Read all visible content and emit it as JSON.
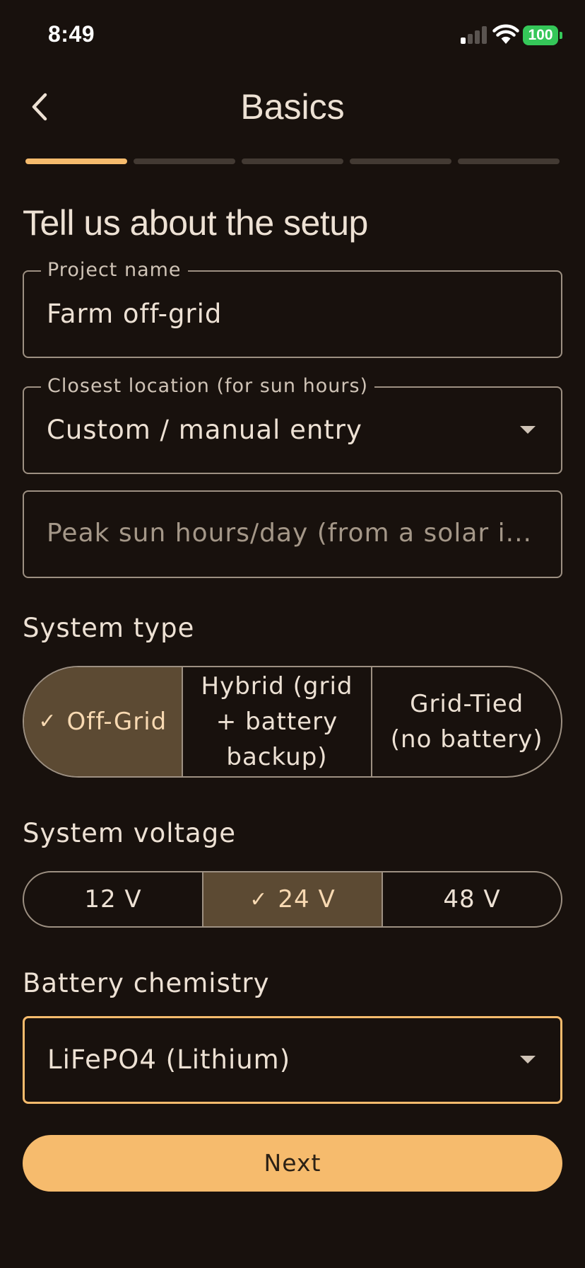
{
  "status_bar": {
    "time": "8:49",
    "battery": "100",
    "battery_color": "#35c759"
  },
  "header": {
    "title": "Basics",
    "back_icon": "chevron-left-icon"
  },
  "progress": {
    "total_steps": 5,
    "current_step": 1,
    "active_color": "#f6bb6d"
  },
  "form": {
    "heading": "Tell us about the setup",
    "project_name": {
      "label": "Project name",
      "value": "Farm off-grid"
    },
    "location": {
      "label": "Closest location (for sun hours)",
      "value": "Custom / manual entry"
    },
    "sun_hours": {
      "placeholder": "Peak sun hours/day (from a solar i..."
    },
    "system_type": {
      "label": "System type",
      "options": [
        "Off-Grid",
        "Hybrid (grid + battery backup)",
        "Grid-Tied (no battery)"
      ],
      "selected": "Off-Grid"
    },
    "system_voltage": {
      "label": "System voltage",
      "options": [
        "12 V",
        "24 V",
        "48 V"
      ],
      "selected": "24 V"
    },
    "battery_chemistry": {
      "label": "Battery chemistry",
      "value": "LiFePO4 (Lithium)"
    },
    "next_label": "Next"
  },
  "colors": {
    "background": "#18110d",
    "accent": "#f6bb6d",
    "selected_segment": "#5c4a33",
    "outline": "#9d9082"
  }
}
